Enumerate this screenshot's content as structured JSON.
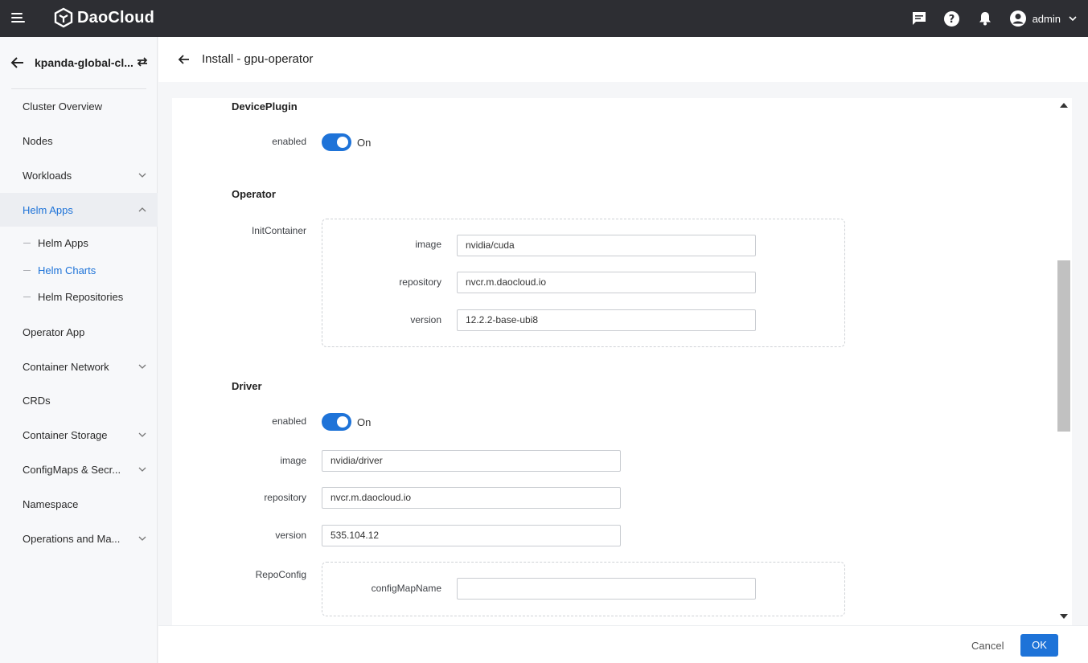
{
  "app": {
    "brand": "DaoCloud"
  },
  "topbar": {
    "user_name": "admin",
    "icons": [
      "menu-icon",
      "message-icon",
      "help-icon",
      "bell-icon",
      "user-avatar-icon",
      "chevron-down-icon"
    ]
  },
  "sidebar": {
    "cluster_name": "kpanda-global-cl...",
    "items": [
      {
        "label": "Cluster Overview"
      },
      {
        "label": "Nodes"
      },
      {
        "label": "Workloads"
      },
      {
        "label": "Helm Apps"
      },
      {
        "label": "Operator App"
      },
      {
        "label": "Container Network"
      },
      {
        "label": "CRDs"
      },
      {
        "label": "Container Storage"
      },
      {
        "label": "ConfigMaps & Secr..."
      },
      {
        "label": "Namespace"
      },
      {
        "label": "Operations and Ma..."
      }
    ],
    "helm_sub": [
      {
        "label": "Helm Apps"
      },
      {
        "label": "Helm Charts"
      },
      {
        "label": "Helm Repositories"
      }
    ]
  },
  "header": {
    "title": "Install - gpu-operator"
  },
  "form": {
    "device_plugin": {
      "title": "DevicePlugin",
      "enabled_label": "enabled",
      "enabled_state": "On"
    },
    "operator": {
      "title": "Operator",
      "init_container_label": "InitContainer",
      "image_label": "image",
      "image_value": "nvidia/cuda",
      "repository_label": "repository",
      "repository_value": "nvcr.m.daocloud.io",
      "version_label": "version",
      "version_value": "12.2.2-base-ubi8"
    },
    "driver": {
      "title": "Driver",
      "enabled_label": "enabled",
      "enabled_state": "On",
      "image_label": "image",
      "image_value": "nvidia/driver",
      "repository_label": "repository",
      "repository_value": "nvcr.m.daocloud.io",
      "version_label": "version",
      "version_value": "535.104.12",
      "repo_config_label": "RepoConfig",
      "config_map_name_label": "configMapName",
      "config_map_name_value": ""
    }
  },
  "footer": {
    "cancel_label": "Cancel",
    "ok_label": "OK"
  },
  "colors": {
    "accent": "#1e73d8",
    "topbar": "#2d2e33"
  }
}
